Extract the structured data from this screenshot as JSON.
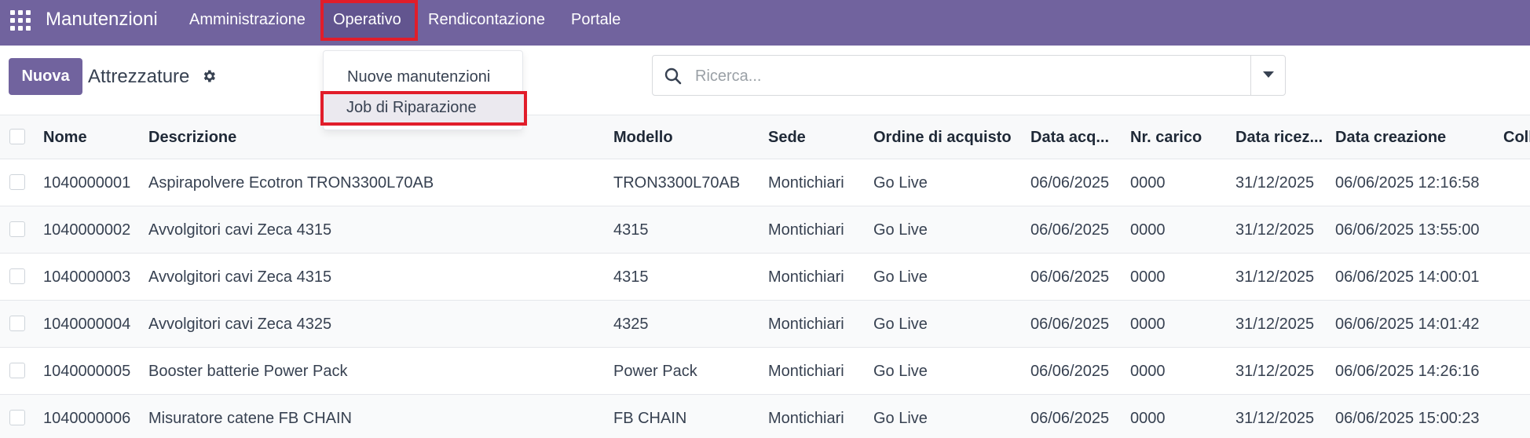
{
  "navbar": {
    "brand": "Manutenzioni",
    "menu": [
      "Amministrazione",
      "Operativo",
      "Rendicontazione",
      "Portale"
    ]
  },
  "dropdown": {
    "items": [
      "Nuove manutenzioni",
      "Job di Riparazione"
    ]
  },
  "control": {
    "new_label": "Nuova",
    "title": "Attrezzature"
  },
  "search": {
    "placeholder": "Ricerca..."
  },
  "table": {
    "headers": [
      "Nome",
      "Descrizione",
      "Modello",
      "Sede",
      "Ordine di acquisto",
      "Data acq...",
      "Nr. carico",
      "Data ricez...",
      "Data creazione",
      "Coll"
    ],
    "rows": [
      [
        "1040000001",
        "Aspirapolvere Ecotron TRON3300L70AB",
        "TRON3300L70AB",
        "Montichiari",
        "Go Live",
        "06/06/2025",
        "0000",
        "31/12/2025",
        "06/06/2025 12:16:58"
      ],
      [
        "1040000002",
        "Avvolgitori cavi Zeca 4315",
        "4315",
        "Montichiari",
        "Go Live",
        "06/06/2025",
        "0000",
        "31/12/2025",
        "06/06/2025 13:55:00"
      ],
      [
        "1040000003",
        "Avvolgitori cavi Zeca 4315",
        "4315",
        "Montichiari",
        "Go Live",
        "06/06/2025",
        "0000",
        "31/12/2025",
        "06/06/2025 14:00:01"
      ],
      [
        "1040000004",
        "Avvolgitori cavi Zeca 4325",
        "4325",
        "Montichiari",
        "Go Live",
        "06/06/2025",
        "0000",
        "31/12/2025",
        "06/06/2025 14:01:42"
      ],
      [
        "1040000005",
        "Booster batterie Power Pack",
        "Power Pack",
        "Montichiari",
        "Go Live",
        "06/06/2025",
        "0000",
        "31/12/2025",
        "06/06/2025 14:26:16"
      ],
      [
        "1040000006",
        "Misuratore catene FB CHAIN",
        "FB CHAIN",
        "Montichiari",
        "Go Live",
        "06/06/2025",
        "0000",
        "31/12/2025",
        "06/06/2025 15:00:23"
      ]
    ]
  },
  "colors": {
    "navbar": "#71639e",
    "highlight_border": "#e11d2a"
  }
}
